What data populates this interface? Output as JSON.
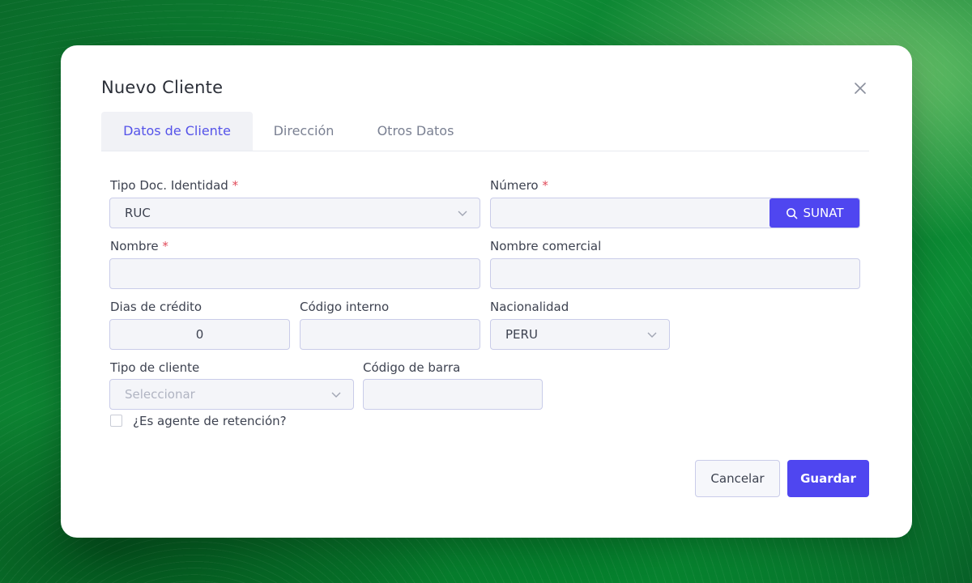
{
  "modal": {
    "title": "Nuevo Cliente",
    "close_icon": "close-icon"
  },
  "tabs": [
    {
      "label": "Datos de Cliente",
      "active": true
    },
    {
      "label": "Dirección",
      "active": false
    },
    {
      "label": "Otros Datos",
      "active": false
    }
  ],
  "form": {
    "required_mark": "*",
    "tipo_doc": {
      "label": "Tipo Doc. Identidad",
      "value": "RUC"
    },
    "numero": {
      "label": "Número",
      "value": "",
      "search_button": "SUNAT",
      "search_icon": "search-icon"
    },
    "nombre": {
      "label": "Nombre",
      "value": ""
    },
    "nombre_comercial": {
      "label": "Nombre comercial",
      "value": ""
    },
    "dias_credito": {
      "label": "Dias de crédito",
      "value": "0"
    },
    "codigo_interno": {
      "label": "Código interno",
      "value": ""
    },
    "nacionalidad": {
      "label": "Nacionalidad",
      "value": "PERU"
    },
    "tipo_cliente": {
      "label": "Tipo de cliente",
      "placeholder": "Seleccionar"
    },
    "codigo_barra": {
      "label": "Código de barra",
      "value": ""
    },
    "agente_retencion": {
      "label": "¿Es agente de retención?",
      "checked": false
    }
  },
  "actions": {
    "cancel": "Cancelar",
    "save": "Guardar"
  },
  "colors": {
    "accent": "#4f46f0",
    "required": "#e14b5a",
    "background": "#0d8a34"
  }
}
